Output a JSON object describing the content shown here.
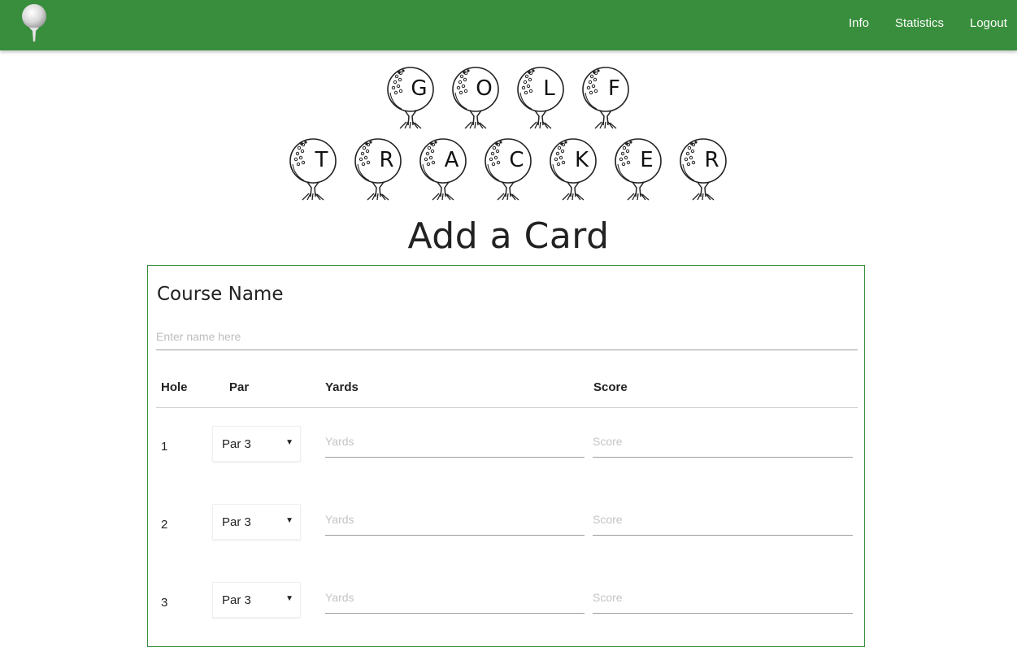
{
  "navbar": {
    "brand_icon": "golf-ball-on-tee-icon",
    "links": [
      "Info",
      "Statistics",
      "Logout"
    ],
    "color": "#388e3c"
  },
  "logo_title": {
    "line1": [
      "G",
      "O",
      "L",
      "F"
    ],
    "line2": [
      "T",
      "R",
      "A",
      "C",
      "K",
      "E",
      "R"
    ]
  },
  "page_title": "Add a Card",
  "form": {
    "border_color": "#388e3c",
    "course_label": "Course Name",
    "course_placeholder": "Enter name here",
    "course_value": "",
    "columns": [
      "Hole",
      "Par",
      "Yards",
      "Score"
    ],
    "yards_placeholder": "Yards",
    "score_placeholder": "Score",
    "rows": [
      {
        "hole": "1",
        "par": "Par 3"
      },
      {
        "hole": "2",
        "par": "Par 3"
      },
      {
        "hole": "3",
        "par": "Par 3"
      }
    ]
  }
}
